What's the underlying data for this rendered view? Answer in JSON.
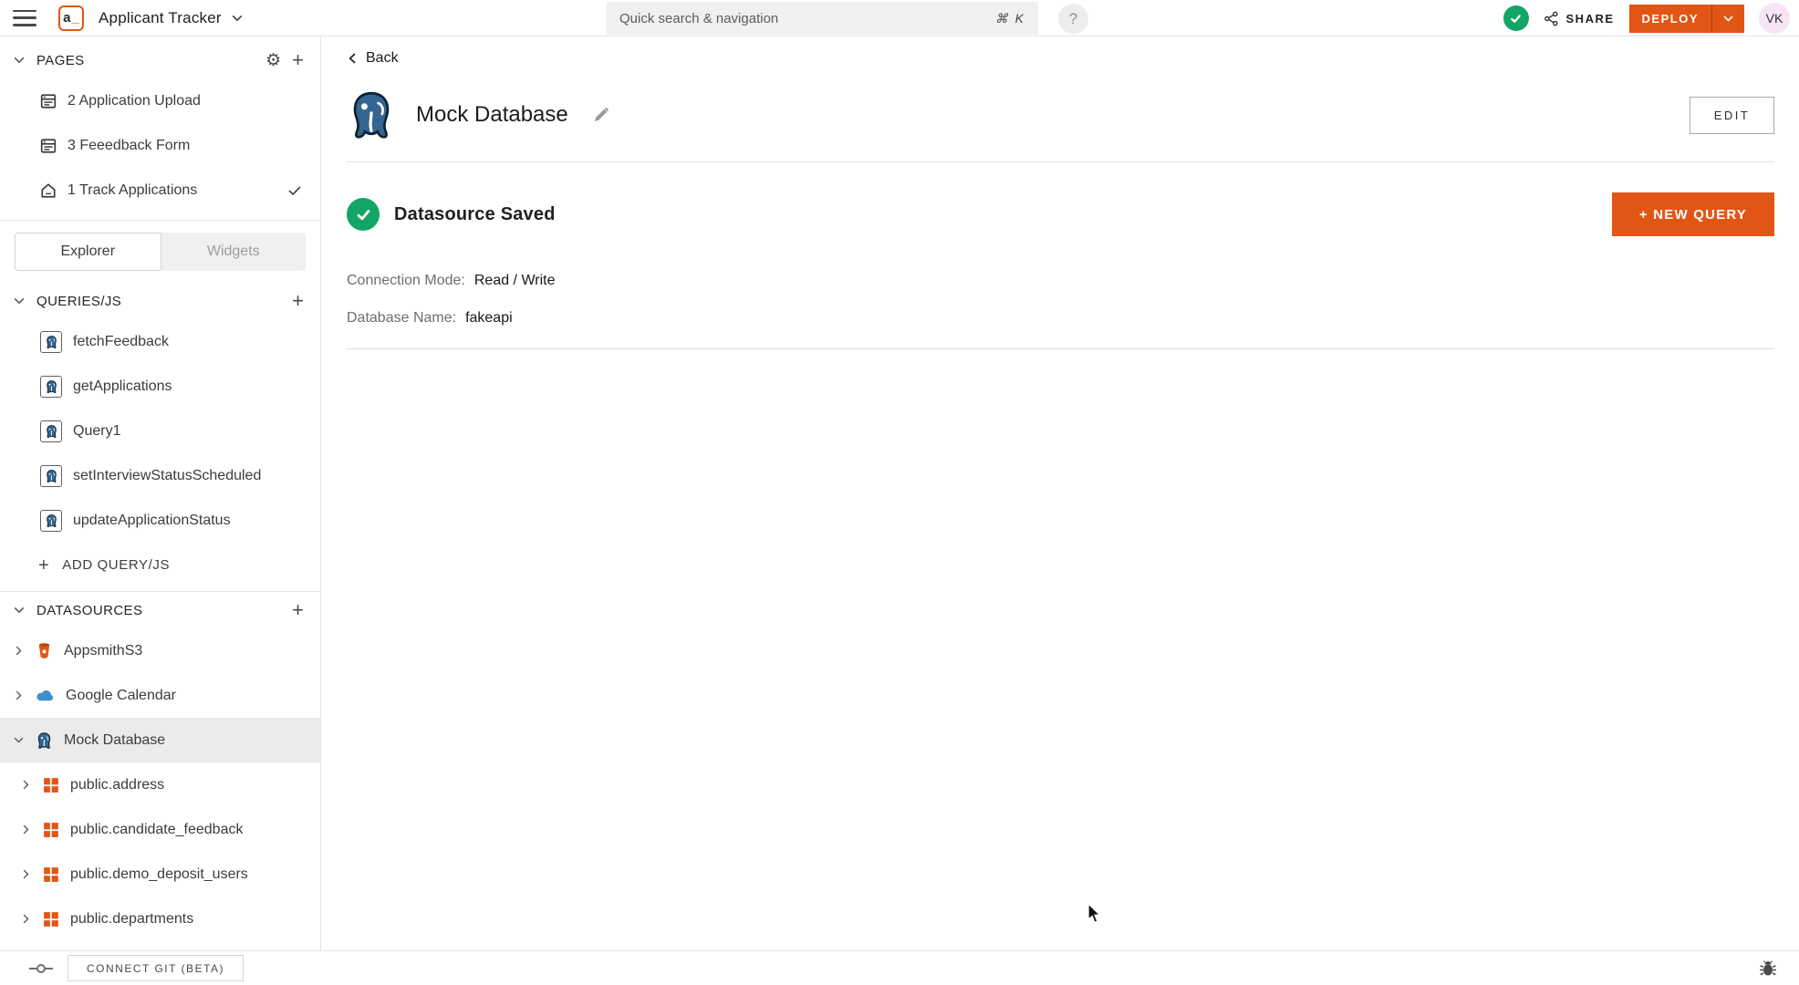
{
  "header": {
    "logo_a": "a",
    "logo_underscore": "_",
    "app_title": "Applicant Tracker",
    "search_placeholder": "Quick search & navigation",
    "search_shortcut": "⌘ K",
    "help_glyph": "?",
    "share_label": "SHARE",
    "deploy_label": "DEPLOY",
    "avatar_initials": "VK"
  },
  "sidebar": {
    "pages": {
      "title": "PAGES",
      "items": [
        {
          "label": "2 Application Upload"
        },
        {
          "label": "3 Feeedback Form"
        },
        {
          "label": "1 Track Applications"
        }
      ]
    },
    "tabs": {
      "explorer": "Explorer",
      "widgets": "Widgets"
    },
    "queries": {
      "title": "QUERIES/JS",
      "items": [
        "fetchFeedback",
        "getApplications",
        "Query1",
        "setInterviewStatusScheduled",
        "updateApplicationStatus"
      ],
      "add_label": "ADD QUERY/JS"
    },
    "datasources": {
      "title": "DATASOURCES",
      "items": [
        {
          "label": "AppsmithS3"
        },
        {
          "label": "Google Calendar"
        },
        {
          "label": "Mock Database"
        },
        {
          "label": "public.address"
        },
        {
          "label": "public.candidate_feedback"
        },
        {
          "label": "public.demo_deposit_users"
        },
        {
          "label": "public.departments"
        }
      ]
    }
  },
  "main": {
    "back_label": "Back",
    "title": "Mock Database",
    "edit_button": "EDIT",
    "status": "Datasource Saved",
    "new_query_button": "+ NEW QUERY",
    "fields": [
      {
        "label": "Connection Mode:",
        "value": "Read / Write"
      },
      {
        "label": "Database Name:",
        "value": "fakeapi"
      }
    ]
  },
  "footer": {
    "connect_git": "CONNECT GIT (BETA)"
  },
  "colors": {
    "accent_orange": "#E15615",
    "success_green": "#12A565",
    "postgres_blue": "#336791",
    "calendar_blue": "#3E8FD0",
    "avatar_pink": "#F7E4F5"
  }
}
